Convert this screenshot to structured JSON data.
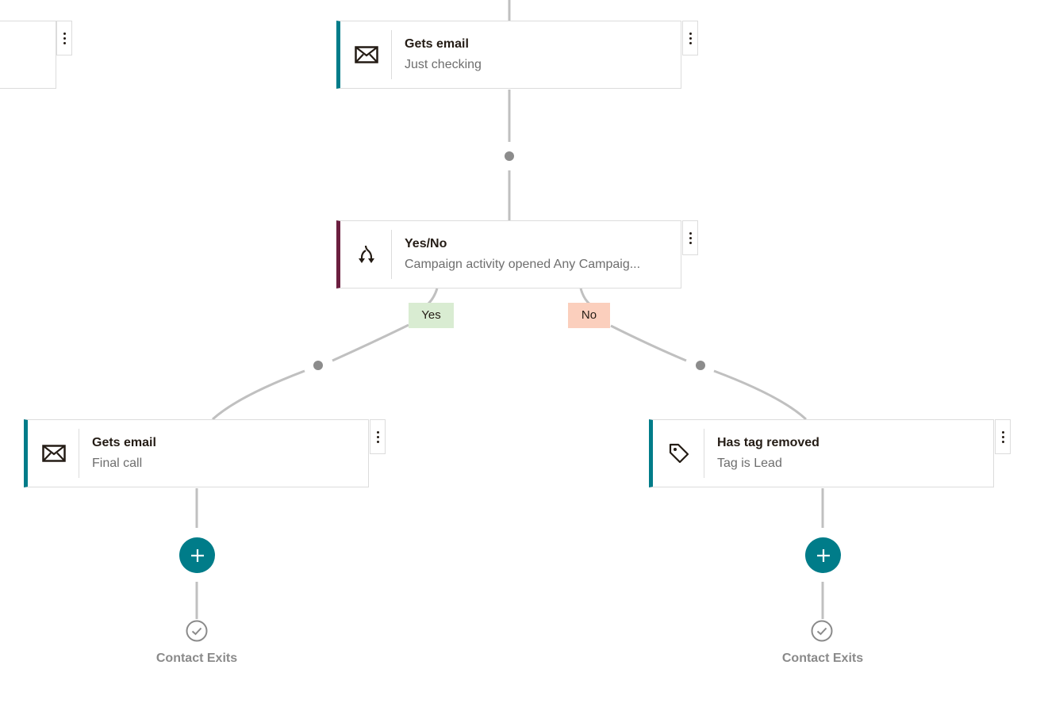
{
  "canvas": {
    "accent_color": "#007c89",
    "split_color": "#6b1e3f",
    "connector_color": "#c0c0c0",
    "dot_color": "#8c8c8c"
  },
  "nodes": [
    {
      "id": "email-just-checking",
      "type": "email",
      "icon": "envelope-icon",
      "title": "Gets email",
      "subtitle": "Just checking"
    },
    {
      "id": "yes-no-split",
      "type": "split",
      "icon": "split-arrows-icon",
      "title": "Yes/No",
      "subtitle": "Campaign activity opened Any Campaig..."
    },
    {
      "id": "email-final-call",
      "type": "email",
      "icon": "envelope-icon",
      "title": "Gets email",
      "subtitle": "Final call"
    },
    {
      "id": "tag-removed",
      "type": "tag",
      "icon": "tag-icon",
      "title": "Has tag removed",
      "subtitle": "Tag is Lead"
    }
  ],
  "branches": {
    "yes_label": "Yes",
    "no_label": "No",
    "yes_color": "#d9ecd2",
    "no_color": "#fbcfbd"
  },
  "exits": {
    "left_label": "Contact Exits",
    "right_label": "Contact Exits"
  }
}
